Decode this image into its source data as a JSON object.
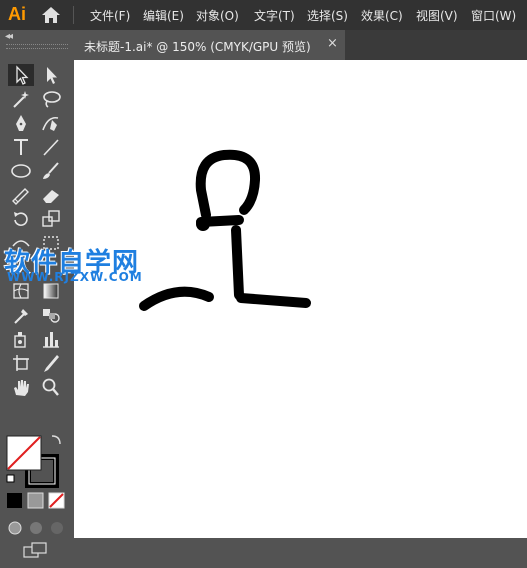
{
  "app": {
    "logo": "Ai"
  },
  "menu": [
    {
      "label": "文件(F)"
    },
    {
      "label": "编辑(E)"
    },
    {
      "label": "对象(O)"
    },
    {
      "label": "文字(T)"
    },
    {
      "label": "选择(S)"
    },
    {
      "label": "效果(C)"
    },
    {
      "label": "视图(V)"
    },
    {
      "label": "窗口(W)"
    }
  ],
  "document_tab": {
    "title": "未标题-1.ai* @ 150% (CMYK/GPU 预览)",
    "close": "×"
  },
  "toolbar": {
    "collapse": "◂◂",
    "tools": [
      "selection-tool",
      "direct-selection-tool",
      "magic-wand-tool",
      "lasso-tool",
      "pen-tool",
      "curvature-tool",
      "type-tool",
      "line-segment-tool",
      "ellipse-tool",
      "paintbrush-tool",
      "shaper-tool",
      "eraser-tool",
      "rotate-tool",
      "scale-tool",
      "mesh-tool",
      "gradient-tool",
      "eyedropper-tool",
      "blend-tool",
      "symbol-sprayer-tool",
      "column-graph-tool",
      "artboard-tool",
      "slice-tool",
      "hand-tool",
      "zoom-tool"
    ],
    "fill_color": "#ffffff",
    "stroke_color": "#000000"
  },
  "watermark": {
    "title": "软件自学网",
    "url": "WWW.RJZXW.COM",
    "color": "#1f7fe0"
  }
}
